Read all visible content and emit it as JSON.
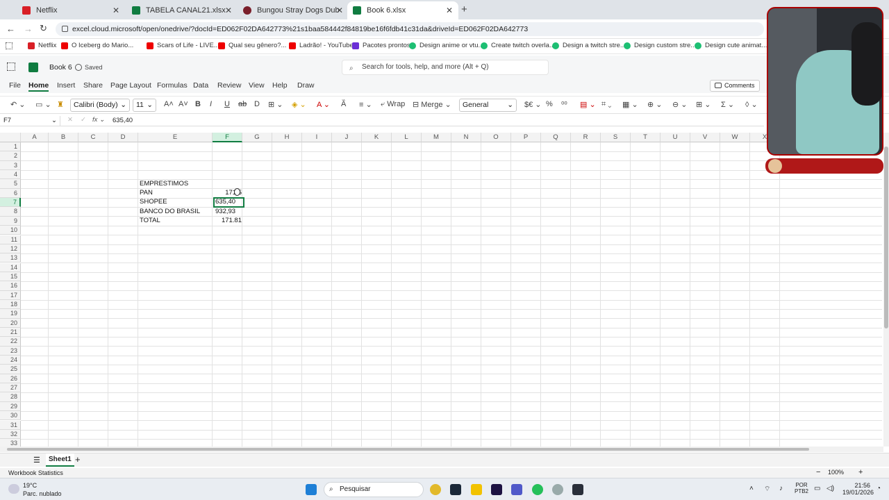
{
  "browser": {
    "tabs": [
      {
        "label": "Netflix",
        "color": "#d81f26",
        "active": false
      },
      {
        "label": "TABELA CANAL21.xlsx",
        "color": "#107c41",
        "active": false
      },
      {
        "label": "Bungou Stray Dogs Dublado Ep",
        "color": "#7a1f2b",
        "active": false
      },
      {
        "label": "Book 6.xlsx",
        "color": "#107c41",
        "active": true
      }
    ],
    "url": "excel.cloud.microsoft/open/onedrive/?docId=ED062F02DA642773%21s1baa584442f84819be16f6fdb41c31da&driveId=ED062F02DA642773",
    "bookmarks": [
      "Netflix",
      "O Iceberg do Mario...",
      "Scars of Life - LIVE...",
      "Qual seu gênero?...",
      "Ladrão! - YouTube",
      "Pacotes prontos",
      "Design anime or vtu...",
      "Create twitch overla...",
      "Design a twitch stre...",
      "Design custom stre...",
      "Design cute animat..."
    ]
  },
  "excel": {
    "doc_title": "Book 6",
    "saved_label": "Saved",
    "search_placeholder": "Search for tools, help, and more (Alt + Q)",
    "menus": [
      "File",
      "Home",
      "Insert",
      "Share",
      "Page Layout",
      "Formulas",
      "Data",
      "Review",
      "View",
      "Help",
      "Draw"
    ],
    "comments_label": "Comments",
    "ribbon": {
      "font": "Calibri (Body)",
      "size": "11",
      "wrap": "Wrap",
      "merge": "Merge",
      "format": "General"
    },
    "name_box": "F7",
    "formula": "635,40",
    "columns": [
      "A",
      "B",
      "C",
      "D",
      "E",
      "F",
      "G",
      "H",
      "I",
      "J",
      "K",
      "L",
      "M",
      "N",
      "O",
      "P",
      "Q",
      "R",
      "S",
      "T",
      "U",
      "V",
      "W",
      "X"
    ],
    "rows": [
      "1",
      "2",
      "3",
      "4",
      "5",
      "6",
      "7",
      "8",
      "9",
      "10",
      "11",
      "12",
      "13",
      "14",
      "15",
      "16",
      "17",
      "18",
      "19",
      "20",
      "21",
      "22",
      "23",
      "24",
      "25",
      "26",
      "27",
      "28",
      "29",
      "30",
      "31",
      "32",
      "33"
    ],
    "cells": {
      "E5": "EMPRESTIMOS",
      "E6": "PAN",
      "E7": "SHOPEE",
      "E8": "BANCO DO BRASIL",
      "E9": "TOTAL",
      "F6": "171,5",
      "F7": "635,40",
      "F8": "932,93",
      "F9": "171.81"
    },
    "sheet_tab": "Sheet1",
    "status_left": "Workbook Statistics",
    "zoom": "100%"
  },
  "taskbar": {
    "weather_temp": "19°C",
    "weather_desc": "Parc. nublado",
    "search": "Pesquisar",
    "lang1": "POR",
    "lang2": "PTB2",
    "time": "21:56",
    "date": "19/01/2026"
  }
}
